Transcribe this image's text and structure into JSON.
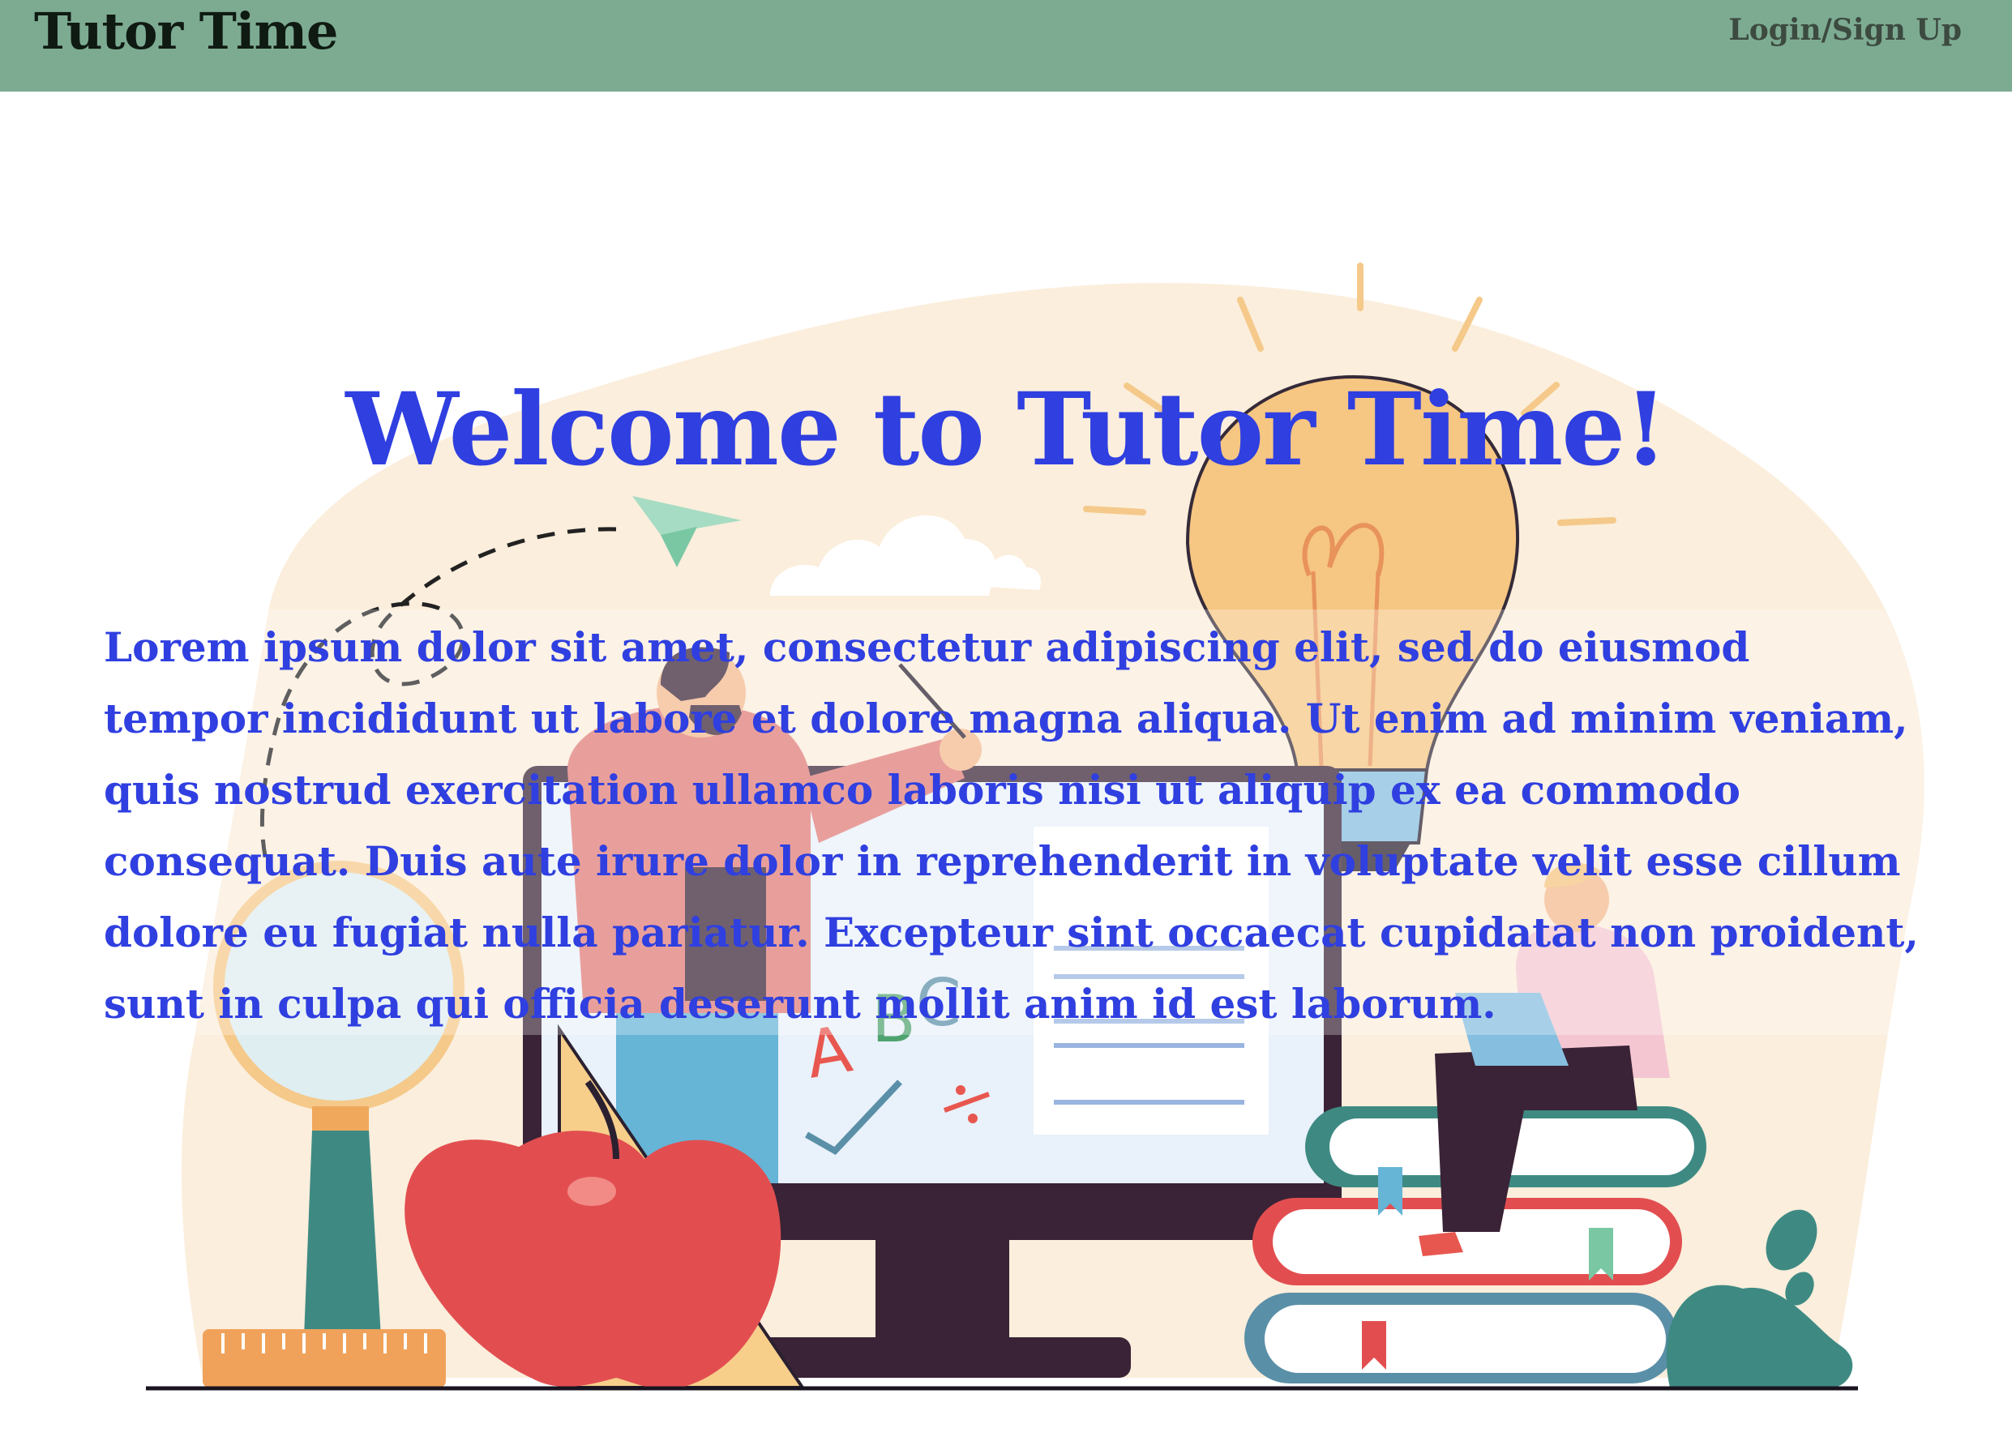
{
  "navbar": {
    "brand": "Tutor Time",
    "login_label": "Login/Sign Up",
    "background": "#7dab92"
  },
  "hero": {
    "title": "Welcome to Tutor Time!",
    "body": "Lorem ipsum dolor sit amet, consectetur adipiscing elit, sed do eiusmod tempor incididunt ut labore et dolore magna aliqua. Ut enim ad minim veniam, quis nostrud exercitation ullamco laboris nisi ut aliquip ex ea commodo consequat. Duis aute irure dolor in reprehenderit in voluptate velit esse cillum dolore eu fugiat nulla pariatur. Excepteur sint occaecat cupidatat non proident, sunt in culpa qui officia deserunt mollit anim id est laborum.",
    "text_color": "#2f3fe0"
  },
  "illustration": {
    "letters": [
      "A",
      "B",
      "C"
    ],
    "icons": [
      "paper-plane-icon",
      "cloud-icon",
      "lightbulb-icon",
      "magnifier-icon",
      "apple-icon",
      "ruler-icon",
      "set-square-icon",
      "monitor-icon",
      "books-icon",
      "laptop-icon",
      "plant-icon"
    ]
  }
}
